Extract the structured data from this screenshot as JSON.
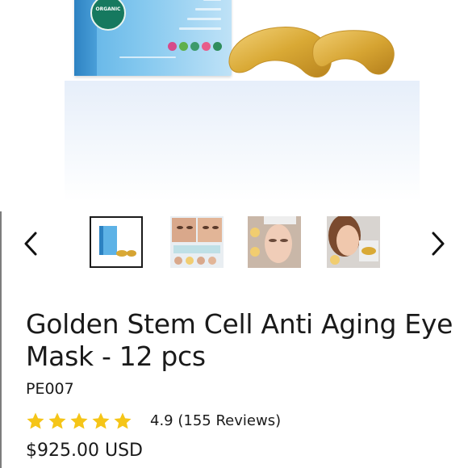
{
  "product": {
    "title": "Golden Stem Cell Anti Aging Eye Mask - 12 pcs",
    "sku": "PE007",
    "rating_value": "4.9",
    "reviews_label": "(155 Reviews)",
    "stars": 5,
    "price": "$925.00 USD"
  },
  "gallery": {
    "hero_image": "eye-mask-box-hero",
    "box_seal_text": "ORGANIC",
    "prev_icon": "chevron-left-icon",
    "next_icon": "chevron-right-icon",
    "selected_index": 0,
    "thumbnails": [
      "product-box-thumbnail",
      "before-after-thumbnail",
      "woman-applying-mask-thumbnail",
      "woman-holding-mask-thumbnail"
    ]
  },
  "colors": {
    "text": "#1a1a1a",
    "star": "#f5c518",
    "box_blue": "#5db2e6",
    "mask_gold": "#d9a935"
  }
}
